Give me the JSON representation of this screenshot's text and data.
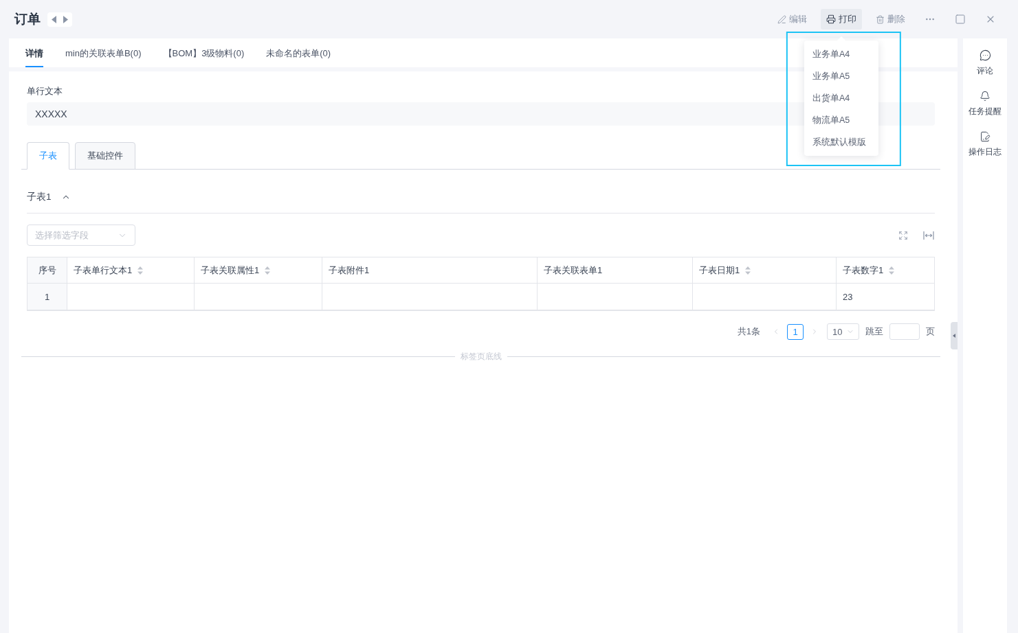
{
  "header": {
    "title": "订单",
    "actions": [
      {
        "kind": "edit",
        "label": "编辑",
        "expanded": false
      },
      {
        "kind": "print",
        "label": "打印",
        "expanded": true,
        "menu": [
          "业务单A4",
          "业务单A5",
          "出货单A4",
          "物流单A5",
          "系统默认模版"
        ]
      },
      {
        "kind": "delete",
        "label": "删除",
        "expanded": false
      }
    ]
  },
  "tabs": [
    {
      "label": "详情",
      "selected": true
    },
    {
      "label": "min的关联表单B(0)",
      "selected": false
    },
    {
      "label": "【BOM】3级物料(0)",
      "selected": false
    },
    {
      "label": "未命名的表单(0)",
      "selected": false
    }
  ],
  "field": {
    "label": "单行文本",
    "value": "XXXXX"
  },
  "sub_tabs": [
    {
      "label": "子表",
      "selected": true
    },
    {
      "label": "基础控件",
      "selected": false
    }
  ],
  "section": {
    "title": "子表1",
    "expanded": true
  },
  "filter": {
    "placeholder": "选择筛选字段"
  },
  "table": {
    "columns": [
      {
        "label": "序号",
        "sortable": false
      },
      {
        "label": "子表单行文本1",
        "sortable": true
      },
      {
        "label": "子表关联属性1",
        "sortable": true
      },
      {
        "label": "子表附件1",
        "sortable": false
      },
      {
        "label": "子表关联表单1",
        "sortable": false
      },
      {
        "label": "子表日期1",
        "sortable": true
      },
      {
        "label": "子表数字1",
        "sortable": true
      }
    ],
    "rows": [
      [
        "1",
        null,
        null,
        null,
        null,
        null,
        "23"
      ]
    ]
  },
  "pagination": {
    "total": "共1条",
    "current_page": "1",
    "page_size": "10",
    "jump_label": "跳至",
    "page_unit": "页"
  },
  "divider": {
    "label": "标签页底线"
  },
  "sidebar": {
    "items": [
      {
        "kind": "comment",
        "label": "评论"
      },
      {
        "kind": "reminder",
        "label": "任务提醒"
      },
      {
        "kind": "log",
        "label": "操作日志"
      }
    ]
  }
}
